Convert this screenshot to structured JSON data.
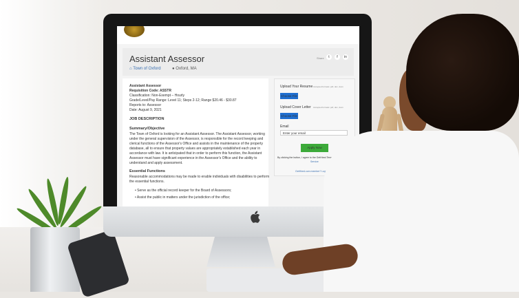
{
  "page": {
    "title": "Assistant Assessor",
    "location_town": "Town of Oxford",
    "location_city": "Oxford, MA",
    "share_label": "Share",
    "share_icons": [
      "twitter-icon",
      "facebook-icon",
      "linkedin-icon"
    ]
  },
  "job": {
    "name_line": "Assistant Assessor",
    "req_code": "Requisition Code: ASSTR",
    "classification": "Classification: Non-Exempt – Hourly",
    "grade": "Grade/Level/Pay Range: Level 11; Steps 2-12; Range $20.46 - $30.87",
    "reports_to": "Reports to: Assessor",
    "date": "Date: August 9, 2021",
    "section_heading": "JOB DESCRIPTION",
    "summary_heading": "Summary/Objective",
    "summary_lines": [
      "The Town of Oxford is looking for an Assistant Assessor. The Assistant Assessor, working",
      "under the general supervision of the Assessor, is responsible for the record keeping and",
      "clerical functions of the Assessor's Office and assists in the maintenance of the property",
      "database, all to ensure that property values are appropriately established each year in",
      "accordance with law. It is anticipated that in order to perform this function, the Assistant",
      "Assessor must have significant experience in the Assessor's Office and the ability to",
      "understand and apply assessment."
    ],
    "essential_heading": "Essential Functions",
    "essential_lines": [
      "Reasonable accommodations may be made to enable individuals with disabilities to perform",
      "the essential functions."
    ],
    "bullets": [
      "Serve as the official record keeper for the Board of Assessors;",
      "Assist the public in matters under the jurisdiction of the office;"
    ]
  },
  "apply": {
    "resume_label": "Upload Your Resume",
    "resume_hint": "Accepted formats: pdf, doc, docx",
    "choose_file": "Choose File",
    "cover_label": "Upload Cover Letter",
    "cover_hint": "Accepted formats: pdf, doc, docx",
    "email_label": "Email",
    "email_placeholder": "Enter your email",
    "apply_button": "Apply Now",
    "terms_line1": "By clicking the button, I agree to the GetHired Terms of",
    "terms_line2": "Service",
    "member_line": "GetHired.com member? Login to Apply"
  },
  "colors": {
    "accent_blue": "#1f6fd1",
    "apply_green": "#3daa3a"
  }
}
